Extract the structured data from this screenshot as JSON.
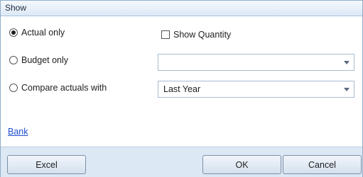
{
  "group": {
    "title": "Show"
  },
  "options": {
    "actual_only": "Actual only",
    "budget_only": "Budget only",
    "compare_actuals": "Compare actuals with"
  },
  "checkbox": {
    "show_quantity": "Show Quantity"
  },
  "combos": {
    "budget_value": "",
    "compare_value": "Last Year"
  },
  "link": {
    "bank": "Bank"
  },
  "buttons": {
    "excel": "Excel",
    "ok": "OK",
    "cancel": "Cancel"
  }
}
